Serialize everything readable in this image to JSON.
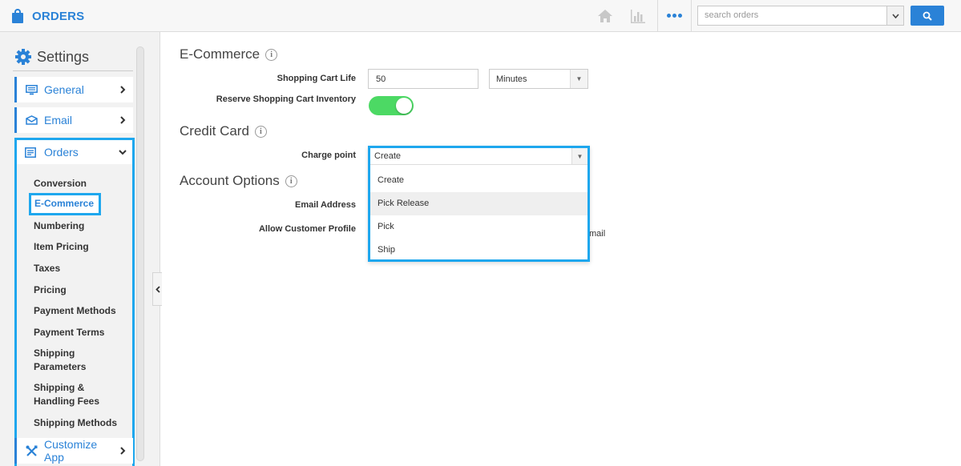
{
  "app": {
    "title": "ORDERS"
  },
  "search": {
    "placeholder": "search orders"
  },
  "sidebar": {
    "heading": "Settings",
    "items": [
      {
        "label": "General",
        "icon": "monitor-icon"
      },
      {
        "label": "Email",
        "icon": "envelope-icon"
      },
      {
        "label": "Orders",
        "icon": "orders-icon"
      }
    ],
    "orders_sub": [
      "Conversion",
      "E-Commerce",
      "Numbering",
      "Item Pricing",
      "Taxes",
      "Pricing",
      "Payment Methods",
      "Payment Terms",
      "Shipping Parameters",
      "Shipping & Handling Fees",
      "Shipping Methods"
    ],
    "active_sub": "E-Commerce",
    "customize": "Customize App"
  },
  "main": {
    "ecommerce": {
      "title": "E-Commerce",
      "cart_life_label": "Shopping Cart Life",
      "cart_life_value": "50",
      "cart_life_unit": "Minutes",
      "reserve_label": "Reserve Shopping Cart Inventory",
      "reserve_on": true
    },
    "credit_card": {
      "title": "Credit Card",
      "charge_label": "Charge point",
      "charge_value": "Create",
      "options": [
        "Create",
        "Pick Release",
        "Pick",
        "Ship"
      ],
      "highlighted_option": "Pick Release"
    },
    "account": {
      "title": "Account Options",
      "email_label": "Email Address",
      "profile_label": "Allow Customer Profile",
      "email_tail": "mail"
    }
  },
  "colors": {
    "accent": "#2a82d7",
    "highlight": "#1ea7ee",
    "toggle_on": "#4cd964"
  }
}
